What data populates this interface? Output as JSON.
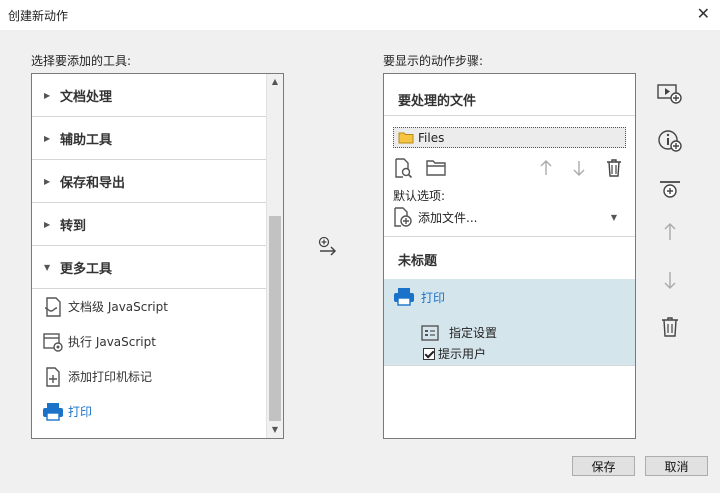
{
  "window": {
    "title": "创建新动作",
    "close_glyph": "✕"
  },
  "left": {
    "label": "选择要添加的工具:",
    "groups": [
      "文档处理",
      "辅助工具",
      "保存和导出",
      "转到",
      "更多工具"
    ],
    "tools": [
      {
        "label": "文档级 JavaScript",
        "icon": "document-script-icon"
      },
      {
        "label": "执行 JavaScript",
        "icon": "execute-script-icon"
      },
      {
        "label": "添加打印机标记",
        "icon": "printer-marks-icon"
      },
      {
        "label": "打印",
        "icon": "printer-icon"
      }
    ]
  },
  "right": {
    "label": "要显示的动作步骤:",
    "section1_title": "要处理的文件",
    "files_label": "Files",
    "default_label": "默认选项:",
    "add_files_label": "添加文件...",
    "section2_title": "未标题",
    "print_label": "打印",
    "specify_settings_label": "指定设置",
    "prompt_user_label": "提示用户",
    "prompt_user_checked": true
  },
  "buttons": {
    "save": "保存",
    "cancel": "取消"
  },
  "colors": {
    "accent_blue": "#1a73c9",
    "selected_bg": "#d5e5ec"
  }
}
